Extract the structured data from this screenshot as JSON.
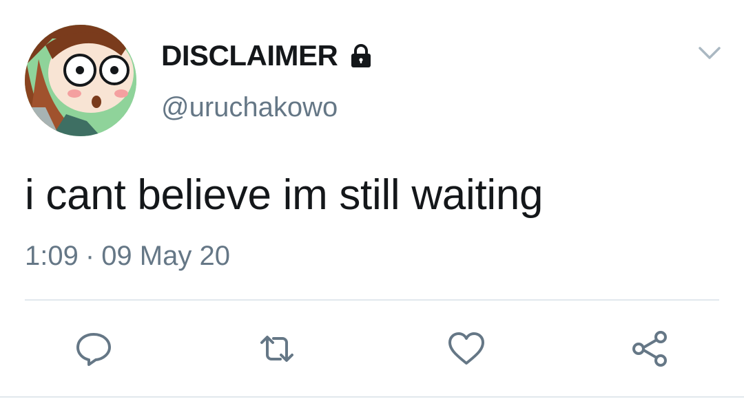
{
  "user": {
    "display_name": "DISCLAIMER",
    "handle": "@uruchakowo",
    "verified_lock_icon": "lock-icon",
    "avatar_icon": "avatar"
  },
  "tweet": {
    "text": "i cant believe im still waiting",
    "time": "1:09",
    "separator": "·",
    "date": "09 May 20"
  },
  "actions": [
    {
      "name": "reply",
      "icon": "speech-bubble-icon"
    },
    {
      "name": "retweet",
      "icon": "retweet-arrows-icon"
    },
    {
      "name": "like",
      "icon": "heart-icon"
    },
    {
      "name": "share",
      "icon": "share-nodes-icon"
    }
  ],
  "colors": {
    "text_primary": "#14171a",
    "text_secondary": "#657786",
    "icon": "#657786",
    "divider": "#e1e8ed"
  }
}
